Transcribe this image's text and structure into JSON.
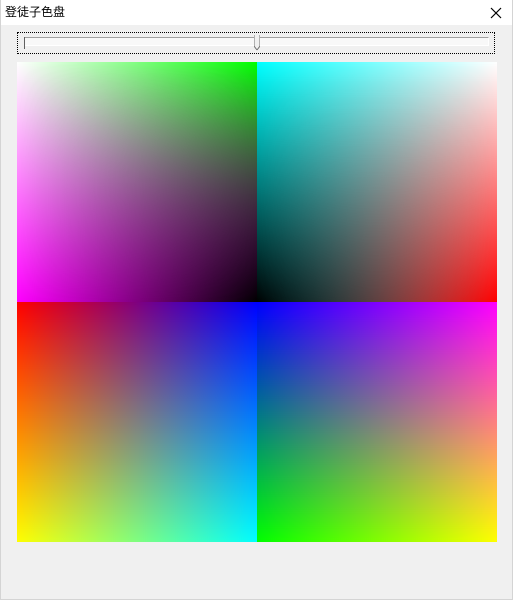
{
  "window": {
    "title": "登徒子色盘"
  },
  "icons": {
    "close": "close-icon"
  },
  "slider": {
    "value_fraction": 0.5
  },
  "palette": {
    "quadrants": [
      {
        "name": "top-left",
        "colors": [
          "#00ff00",
          "#ff00ff",
          "#ffffff",
          "#000000"
        ]
      },
      {
        "name": "top-right",
        "colors": [
          "#00ffff",
          "#ff0000",
          "#ffffff",
          "#000000"
        ]
      },
      {
        "name": "bottom-left",
        "colors": [
          "#ff0000",
          "#0000ff",
          "#ffff00",
          "#00ffff"
        ]
      },
      {
        "name": "bottom-right",
        "colors": [
          "#0000ff",
          "#ff00ff",
          "#00ff00",
          "#ffff00"
        ]
      }
    ]
  }
}
